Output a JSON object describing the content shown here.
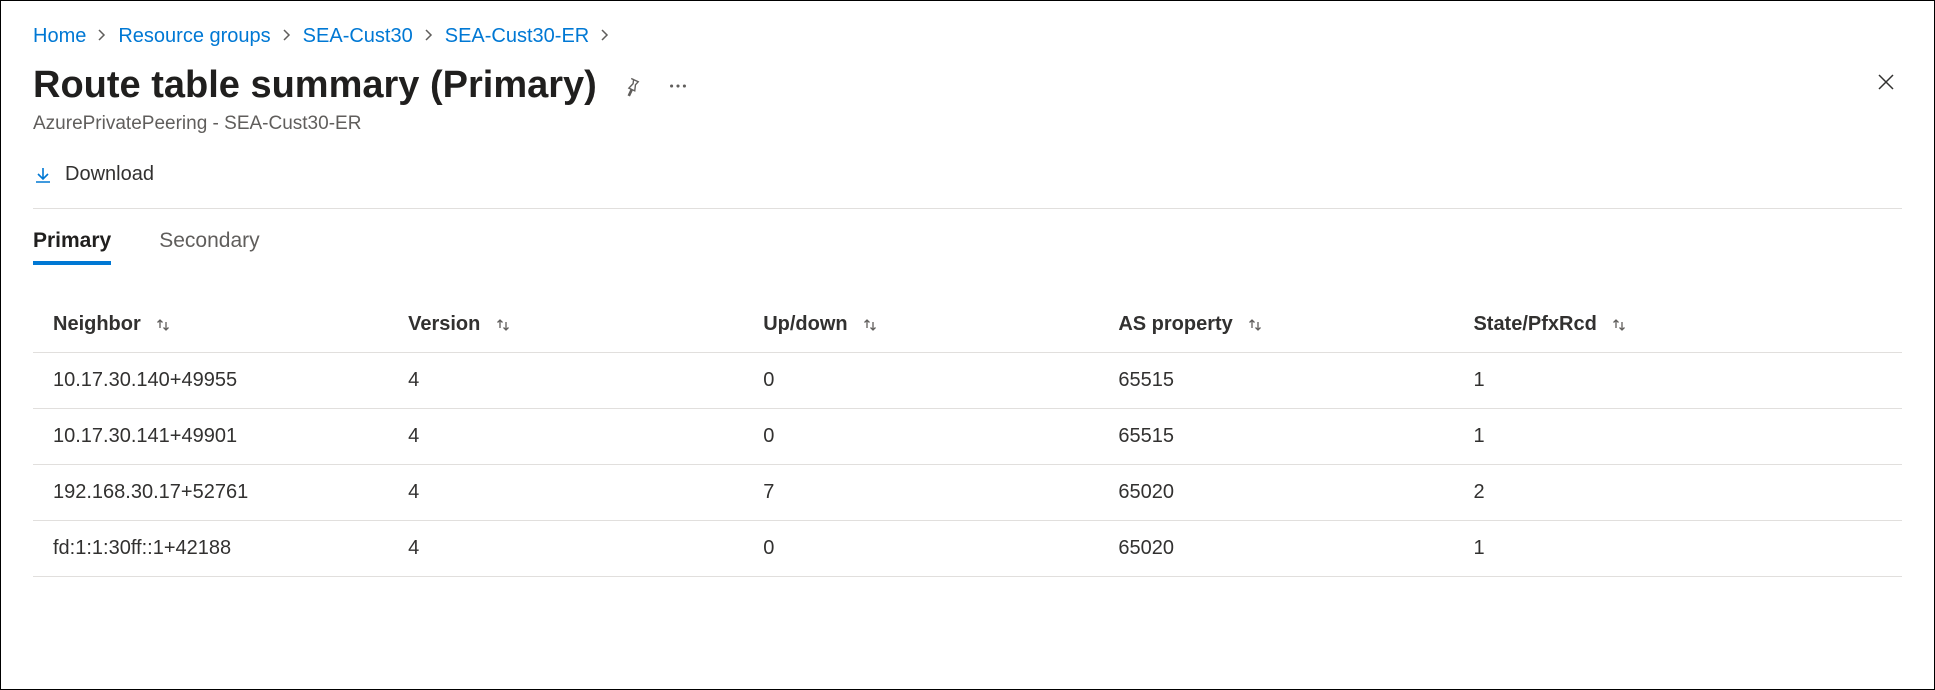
{
  "breadcrumb": [
    {
      "label": "Home"
    },
    {
      "label": "Resource groups"
    },
    {
      "label": "SEA-Cust30"
    },
    {
      "label": "SEA-Cust30-ER"
    }
  ],
  "title": "Route table summary (Primary)",
  "subtitle": "AzurePrivatePeering - SEA-Cust30-ER",
  "toolbar": {
    "download_label": "Download"
  },
  "tabs": [
    {
      "label": "Primary",
      "active": true
    },
    {
      "label": "Secondary",
      "active": false
    }
  ],
  "table": {
    "columns": [
      {
        "label": "Neighbor"
      },
      {
        "label": "Version"
      },
      {
        "label": "Up/down"
      },
      {
        "label": "AS property"
      },
      {
        "label": "State/PfxRcd"
      }
    ],
    "rows": [
      {
        "neighbor": "10.17.30.140+49955",
        "version": "4",
        "updown": "0",
        "asprop": "65515",
        "state": "1"
      },
      {
        "neighbor": "10.17.30.141+49901",
        "version": "4",
        "updown": "0",
        "asprop": "65515",
        "state": "1"
      },
      {
        "neighbor": "192.168.30.17+52761",
        "version": "4",
        "updown": "7",
        "asprop": "65020",
        "state": "2"
      },
      {
        "neighbor": "fd:1:1:30ff::1+42188",
        "version": "4",
        "updown": "0",
        "asprop": "65020",
        "state": "1"
      }
    ]
  }
}
